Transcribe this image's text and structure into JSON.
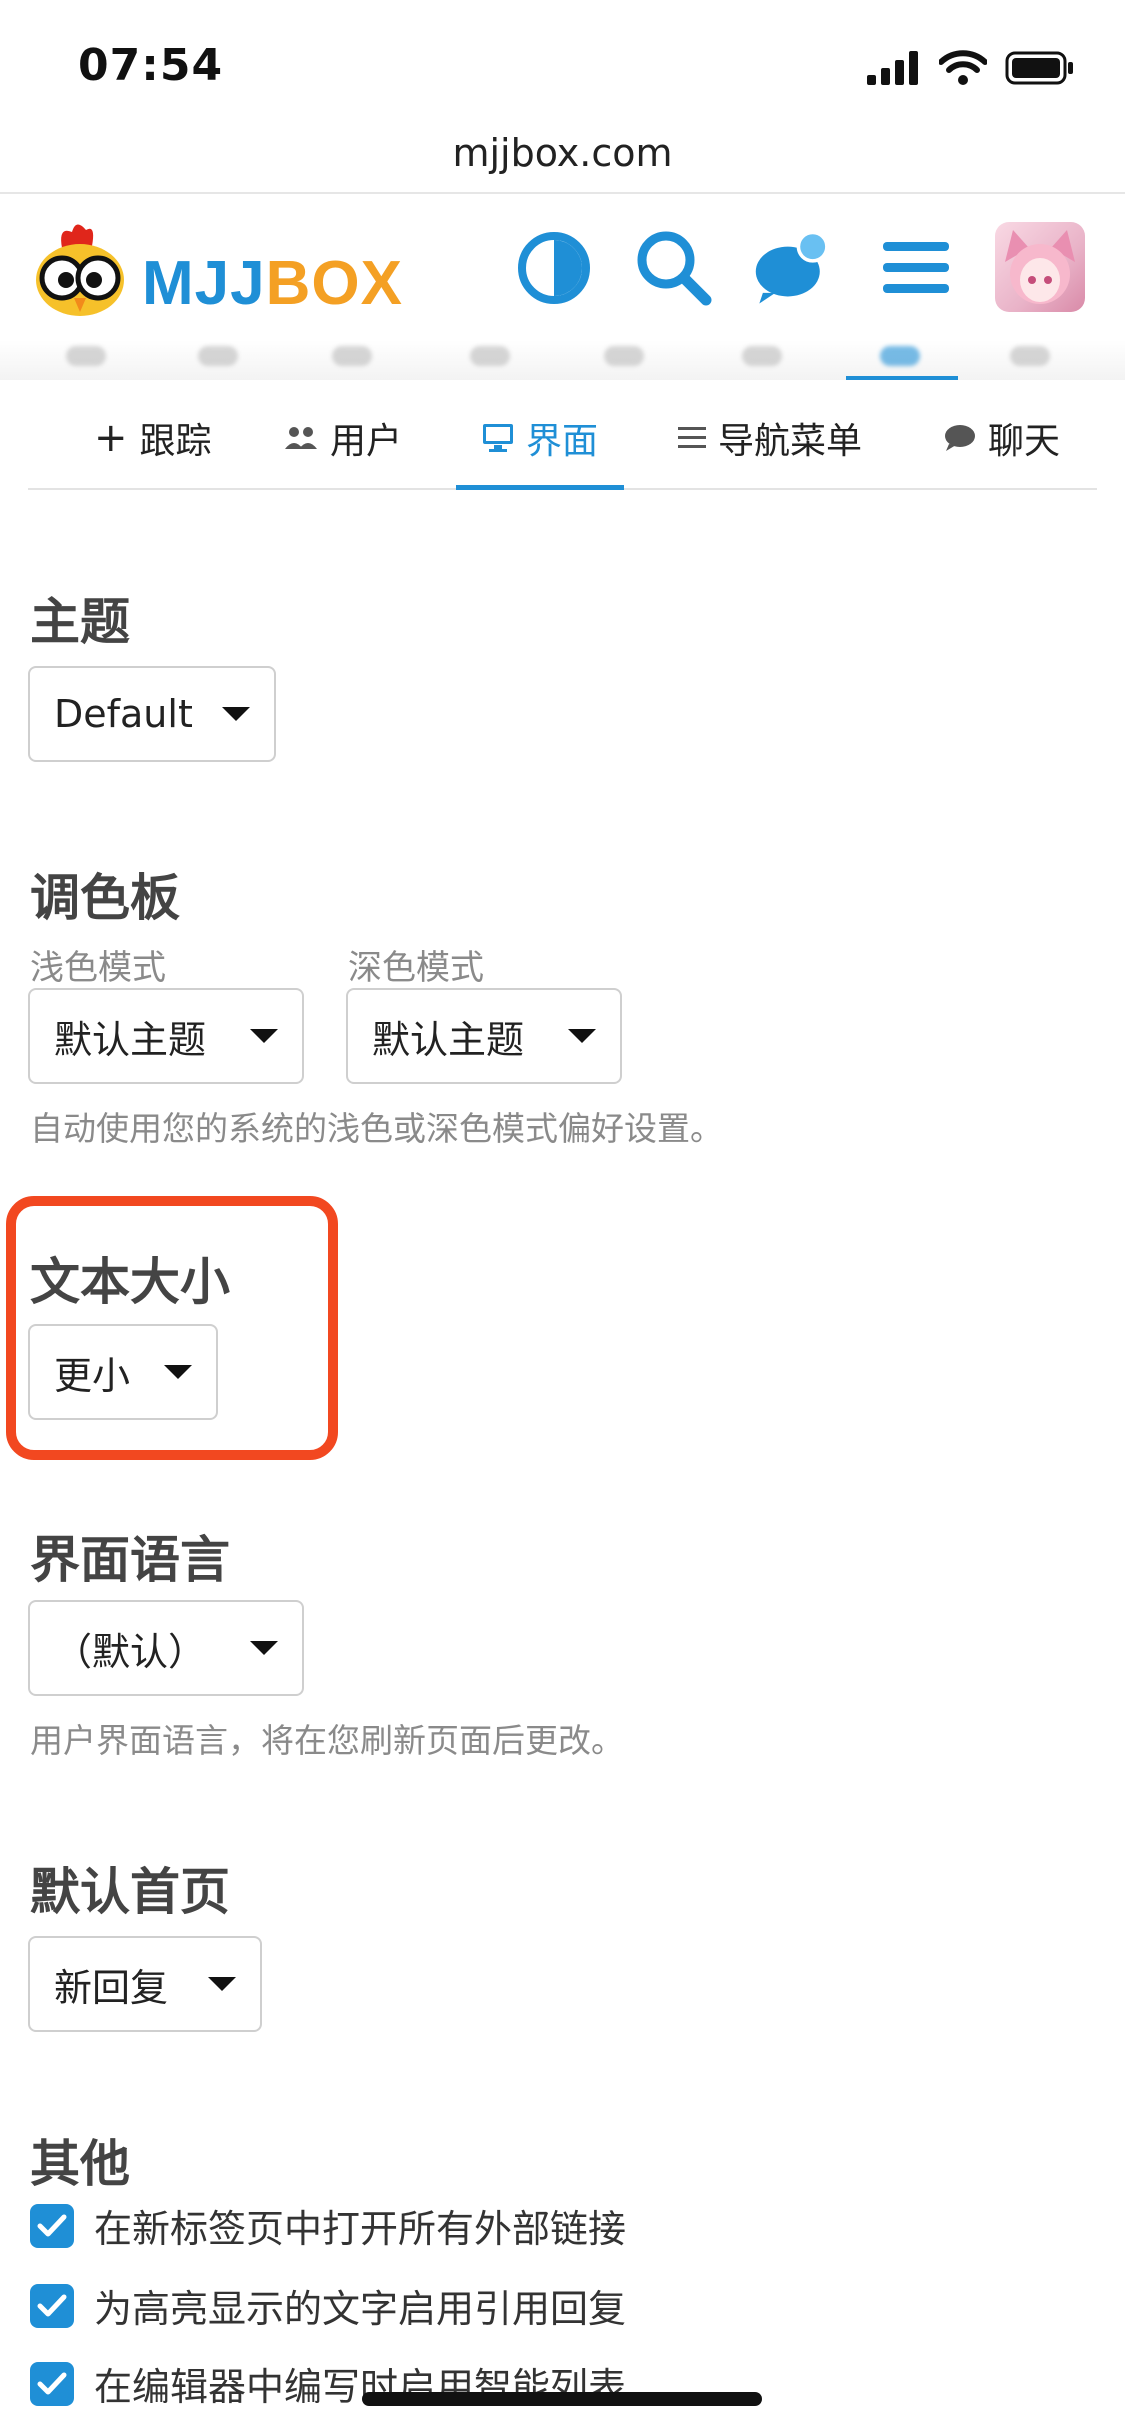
{
  "status_bar": {
    "time": "07:54"
  },
  "browser": {
    "url": "mjjbox.com"
  },
  "header": {
    "logo_text_blue": "MJJ",
    "logo_text_orange": "BOX",
    "icons": [
      "theme-toggle-icon",
      "search-icon",
      "chat-icon",
      "menu-icon"
    ],
    "brand_blue": "#1f8fd6",
    "brand_orange": "#f4a024"
  },
  "subnav": {
    "tabs": [
      {
        "label": "跟踪",
        "icon": "plus-icon",
        "active": false
      },
      {
        "label": "用户",
        "icon": "users-icon",
        "active": false
      },
      {
        "label": "界面",
        "icon": "desktop-icon",
        "active": true
      },
      {
        "label": "导航菜单",
        "icon": "list-icon",
        "active": false
      },
      {
        "label": "聊天",
        "icon": "comment-icon",
        "active": false
      }
    ]
  },
  "settings": {
    "theme": {
      "title": "主题",
      "value": "Default"
    },
    "palette": {
      "title": "调色板",
      "light_label": "浅色模式",
      "light_value": "默认主题",
      "dark_label": "深色模式",
      "dark_value": "默认主题",
      "help": "自动使用您的系统的浅色或深色模式偏好设置。"
    },
    "text_size": {
      "title": "文本大小",
      "value": "更小",
      "highlight_color": "#f24820"
    },
    "locale": {
      "title": "界面语言",
      "value": "（默认）",
      "help": "用户界面语言，将在您刷新页面后更改。"
    },
    "homepage": {
      "title": "默认首页",
      "value": "新回复"
    },
    "other": {
      "title": "其他",
      "checkboxes": [
        {
          "label": "在新标签页中打开所有外部链接",
          "checked": true
        },
        {
          "label": "为高亮显示的文字启用引用回复",
          "checked": true
        },
        {
          "label": "在编辑器中编写时启用智能列表",
          "checked": true
        }
      ]
    }
  }
}
